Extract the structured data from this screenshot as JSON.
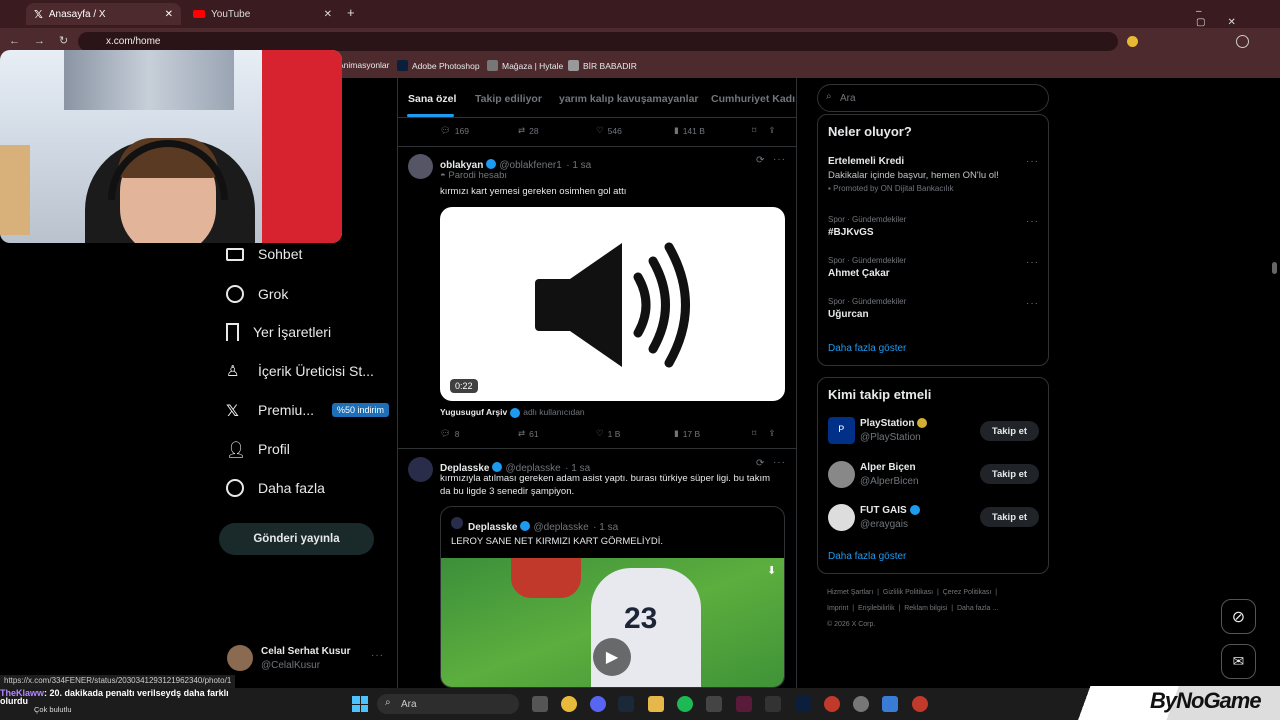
{
  "browser": {
    "tabs": [
      {
        "label": "Anasayfa / X",
        "active": true
      },
      {
        "label": "YouTube",
        "active": false
      }
    ],
    "url": "x.com/home",
    "bookmarks": [
      "Animasyonlar",
      "Adobe Photoshop",
      "Mağaza | Hytale",
      "BİR BABADIR"
    ]
  },
  "nav": {
    "items": [
      {
        "label": "Sohbet",
        "icon": "mail-icon"
      },
      {
        "label": "Grok",
        "icon": "grok-icon"
      },
      {
        "label": "Yer İşaretleri",
        "icon": "bookmark-icon"
      },
      {
        "label": "İçerik Üreticisi St...",
        "icon": "creator-icon"
      },
      {
        "label": "Premiu...",
        "icon": "x-icon",
        "badge": "%50 indirim"
      },
      {
        "label": "Profil",
        "icon": "person-icon"
      },
      {
        "label": "Daha fazla",
        "icon": "more-circle-icon"
      }
    ],
    "post_button": "Gönderi yayınla",
    "account": {
      "name": "Celal Serhat Kusur",
      "handle": "@CelalKusur"
    }
  },
  "feed": {
    "tabs": [
      "Sana özel",
      "Takip ediliyor",
      "yarım kalıp kavuşamayanlar",
      "Cumhuriyet Kadın"
    ],
    "top_actions": {
      "replies": "169",
      "reposts": "28",
      "likes": "546",
      "views": "141 B"
    },
    "post1": {
      "name": "oblakyan",
      "handle": "@oblakfener1",
      "time": "· 1 sa",
      "parody": "Parodi hesabı",
      "text": "kırmızı kart yemesi gereken osimhen gol attı",
      "video_duration": "0:22",
      "from_user": "Yugusuguf Arşiv",
      "from_suffix": "adlı kullanıcıdan",
      "actions": {
        "replies": "8",
        "reposts": "61",
        "likes": "1 B",
        "views": "17 B"
      }
    },
    "post2": {
      "name": "Deplasske",
      "handle": "@deplasske",
      "time": "· 1 sa",
      "text": "kırmızıyla atılması gereken adam asist yaptı. burası türkiye süper ligi. bu takım da bu ligde 3 senedir şampiyon.",
      "quote": {
        "name": "Deplasske",
        "handle": "@deplasske",
        "time": "· 1 sa",
        "text": "LEROY SANE NET KIRMIZI KART GÖRMELİYDİ.",
        "jersey": "23"
      }
    }
  },
  "right": {
    "search_placeholder": "Ara",
    "trends_title": "Neler oluyor?",
    "trends": [
      {
        "meta": "",
        "name": "Ertelemeli Kredi",
        "desc": "Dakikalar içinde başvur, hemen ON'lu ol!",
        "promo": "Promoted by ON Dijital Bankacılık"
      },
      {
        "meta": "Spor · Gündemdekiler",
        "name": "#BJKvGS"
      },
      {
        "meta": "Spor · Gündemdekiler",
        "name": "Ahmet Çakar"
      },
      {
        "meta": "Spor · Gündemdekiler",
        "name": "Uğurcan"
      }
    ],
    "show_more": "Daha fazla göster",
    "follow_title": "Kimi takip etmeli",
    "follow": [
      {
        "name": "PlayStation",
        "handle": "@PlayStation",
        "button": "Takip et"
      },
      {
        "name": "Alper Biçen",
        "handle": "@AlperBicen",
        "button": "Takip et"
      },
      {
        "name": "FUT GAIS",
        "handle": "@eraygais",
        "button": "Takip et"
      }
    ],
    "footer": {
      "line1": [
        "Hizmet Şartları",
        "Gizlilik Politikası",
        "Çerez Politikası"
      ],
      "line2": [
        "Imprint",
        "Erişilebilirlik",
        "Reklam bilgisi",
        "Daha fazla ..."
      ],
      "copyright": "© 2026 X Corp."
    }
  },
  "status_url": "https://x.com/334FENER/status/2030341293121962340/photo/1",
  "chat_overlay": {
    "user": "TheKlaww",
    "message": ": 20. dakikada penaltı verilseydş daha farklı",
    "line2": "olurdu",
    "line3": "Çok bulutlu"
  },
  "taskbar": {
    "search": "Ara"
  },
  "watermark": "ByNoGame",
  "colors": {
    "accent": "#1d9bf0",
    "browser": "#4d2a2e",
    "premium_badge": "#1d6fb8"
  }
}
